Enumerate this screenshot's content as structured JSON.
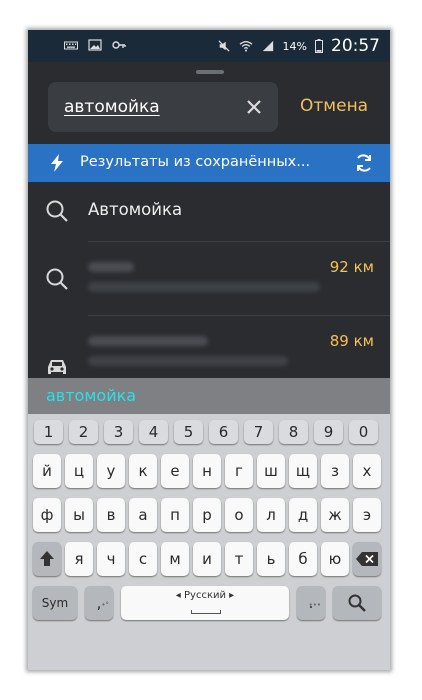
{
  "status_bar": {
    "battery_percent": "14%",
    "time": "20:57",
    "icons_left": [
      "keyboard-icon",
      "image-icon",
      "key-icon"
    ],
    "icons_right": [
      "mute-icon",
      "wifi-icon",
      "signal-icon",
      "battery-icon"
    ]
  },
  "search": {
    "query": "автомойка",
    "clear_icon": "close-icon",
    "cancel_label": "Отмена"
  },
  "banner": {
    "text": "Результаты из сохранённых...",
    "icon": "lightning-icon",
    "action_icon": "refresh-icon"
  },
  "results": [
    {
      "icon": "search-icon",
      "title": "Автомойка",
      "distance": ""
    },
    {
      "icon": "search-icon",
      "title": "",
      "distance": "92 км"
    },
    {
      "icon": "car-icon",
      "title": "",
      "distance": "89 км"
    }
  ],
  "suggestion": "автомойка",
  "keyboard": {
    "numbers": [
      "1",
      "2",
      "3",
      "4",
      "5",
      "6",
      "7",
      "8",
      "9",
      "0"
    ],
    "row1": [
      "й",
      "ц",
      "у",
      "к",
      "е",
      "н",
      "г",
      "ш",
      "щ",
      "з",
      "х"
    ],
    "row2": [
      "ф",
      "ы",
      "в",
      "а",
      "п",
      "р",
      "о",
      "л",
      "д",
      "ж",
      "э"
    ],
    "row3": [
      "я",
      "ч",
      "с",
      "м",
      "и",
      "т",
      "ь",
      "б",
      "ю"
    ],
    "sym_label": "Sym",
    "comma": ",",
    "space_label": "◂ Русский ▸",
    "period": ".",
    "colors": {
      "accent": "#f3c05a",
      "banner": "#2a73c4",
      "suggestion": "#29e0ea"
    }
  }
}
